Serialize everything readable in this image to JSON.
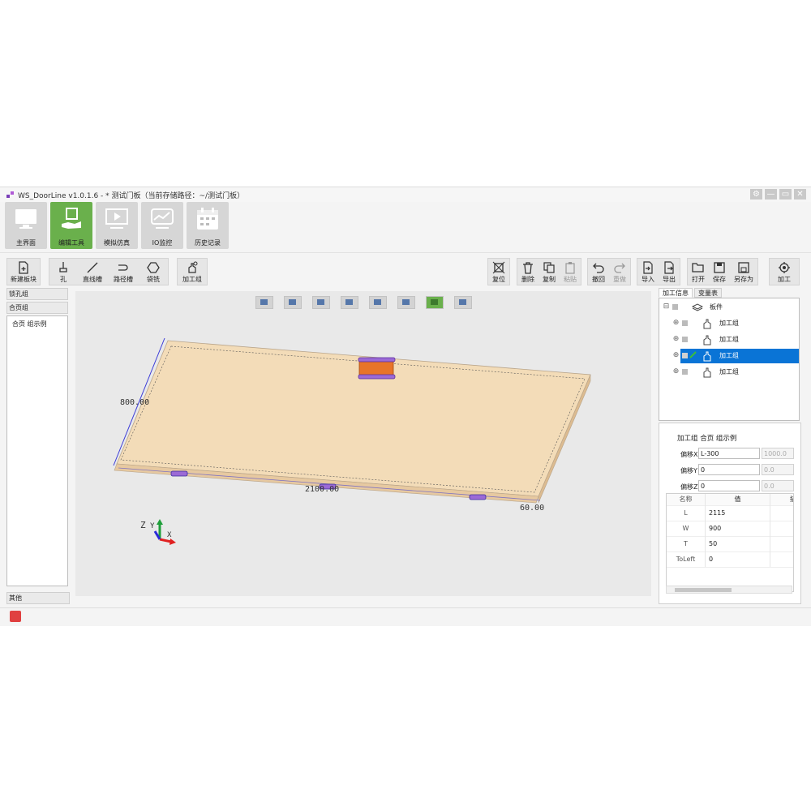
{
  "window": {
    "title": "WS_DoorLine v1.0.1.6 - * 测试门板（当前存储路径：~/测试门板）",
    "controls": [
      "settings-icon",
      "minimize-icon",
      "maximize-icon",
      "close-icon"
    ]
  },
  "nav": {
    "items": [
      {
        "label": "主界面",
        "icon": "monitor-icon",
        "active": false
      },
      {
        "label": "编辑工具",
        "icon": "edit-hand-icon",
        "active": true
      },
      {
        "label": "模拟仿真",
        "icon": "play-screen-icon",
        "active": false
      },
      {
        "label": "IO监控",
        "icon": "chart-monitor-icon",
        "active": false
      },
      {
        "label": "历史记录",
        "icon": "calendar-icon",
        "active": false
      }
    ]
  },
  "toolbar": {
    "new_board": "新建板块",
    "hole": "孔",
    "line_slot": "直线槽",
    "path_slot": "路径槽",
    "pocket": "袋铣",
    "process_group": "加工组",
    "reset": "复位",
    "delete": "删除",
    "copy": "复制",
    "paste": "粘贴",
    "undo": "撤回",
    "redo": "重做",
    "import": "导入",
    "export": "导出",
    "open": "打开",
    "save": "保存",
    "save_as": "另存为",
    "machine": "加工"
  },
  "left_panel": {
    "group1": "锁孔组",
    "group2": "合页组",
    "items": [
      "合页 组示例"
    ],
    "footer": "其他"
  },
  "viewport": {
    "dim_width": "800.00",
    "dim_length": "2100.00",
    "dim_thickness": "60.00",
    "axis_z": "Z",
    "axis_y": "Y",
    "axis_x": "X",
    "board_color": "#f3dcb8",
    "view_buttons": 8,
    "active_view_index": 6
  },
  "right_panel": {
    "tabs": [
      "加工信息",
      "变量表"
    ],
    "tree": {
      "root": "板件",
      "children": [
        "加工组",
        "加工组",
        "加工组",
        "加工组"
      ],
      "selected_index": 2
    },
    "props": {
      "title": "加工组  合页  组示例",
      "rows": [
        {
          "key": "偏移X",
          "value": "L-300",
          "result": "1000.0"
        },
        {
          "key": "偏移Y",
          "value": "0",
          "result": "0.0"
        },
        {
          "key": "偏移Z",
          "value": "0",
          "result": "0.0"
        }
      ],
      "grid_headers": [
        "名称",
        "值",
        "描"
      ],
      "grid_rows": [
        {
          "name": "L",
          "value": "2115"
        },
        {
          "name": "W",
          "value": "900"
        },
        {
          "name": "T",
          "value": "50"
        },
        {
          "name": "ToLeft",
          "value": "0"
        }
      ]
    }
  },
  "colors": {
    "accent": "#6ab04c",
    "selection": "#0a74d6",
    "hinge_purple": "#7a3fb8",
    "hinge_orange": "#e8742a"
  }
}
